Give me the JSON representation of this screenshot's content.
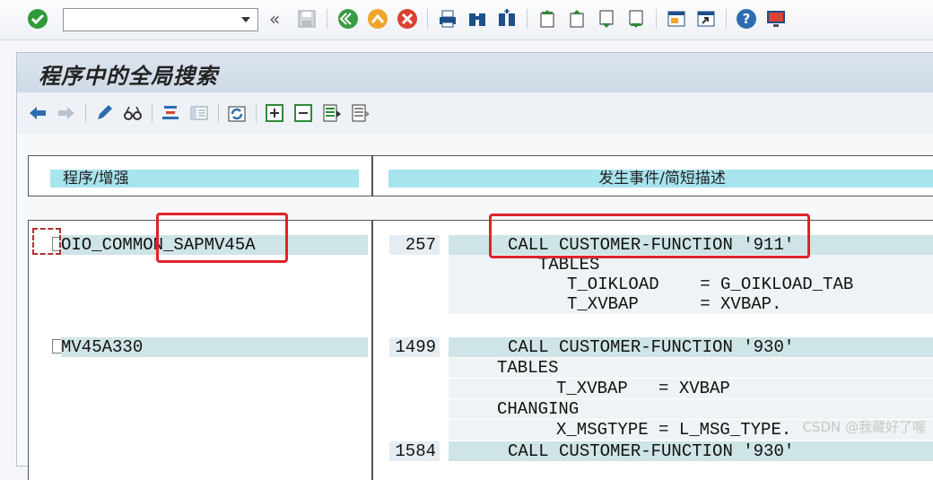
{
  "toolbar": {
    "command_field_value": "",
    "back_arrows": "«"
  },
  "window": {
    "title": "程序中的全局搜索"
  },
  "columns": {
    "program_header": "程序/增强",
    "occurrence_header": "发生事件/简短描述"
  },
  "results": [
    {
      "program": "OIO_COMMON_SAPMV45A",
      "line_no": "257",
      "code": [
        "CALL CUSTOMER-FUNCTION '911'",
        "TABLES",
        "T_OIKLOAD    = G_OIKLOAD_TAB",
        "T_XVBAP      = XVBAP."
      ]
    },
    {
      "program": "MV45A330",
      "line_no": "1499",
      "code": [
        "CALL CUSTOMER-FUNCTION '930'",
        "TABLES",
        "T_XVBAP   = XVBAP",
        "CHANGING",
        "X_MSGTYPE = L_MSG_TYPE."
      ]
    },
    {
      "program": "",
      "line_no": "1584",
      "code": [
        "CALL CUSTOMER-FUNCTION '930'"
      ]
    }
  ],
  "watermark": "CSDN @我藏好了喔",
  "colors": {
    "header_band": "#a8e4ee",
    "highlight_band": "#cfe4e6",
    "annotation_red": "#e0232b"
  }
}
